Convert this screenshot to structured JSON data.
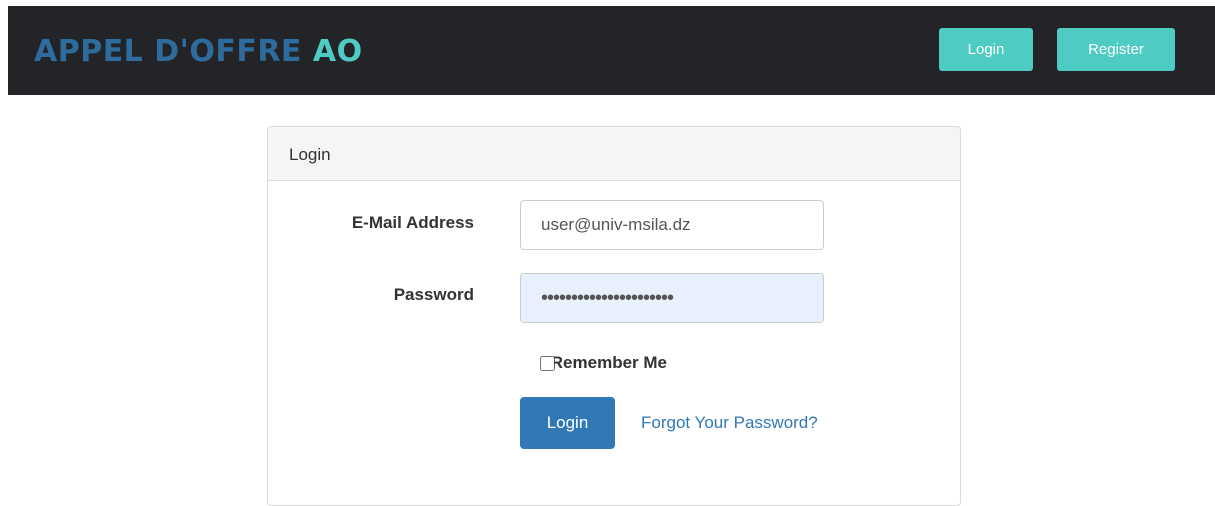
{
  "navbar": {
    "brand_main": "APPEL D'OFFRE ",
    "brand_ao": "AO",
    "login_label": "Login",
    "register_label": "Register"
  },
  "login_panel": {
    "heading": "Login",
    "email_label": "E-Mail Address",
    "email_value": "user@univ-msila.dz",
    "password_label": "Password",
    "password_value": "••••••••••••••••••••••",
    "remember_label": "Remember Me",
    "remember_checked": false,
    "submit_label": "Login",
    "forgot_link": "Forgot Your Password?"
  },
  "colors": {
    "navbar_bg": "#222427",
    "brand_blue": "#2e6c9e",
    "brand_teal": "#4ecbc2",
    "nav_button": "#4ecbc2",
    "primary_button": "#3178b7",
    "link": "#3178b7",
    "autofill_bg": "#e8f0fe"
  }
}
